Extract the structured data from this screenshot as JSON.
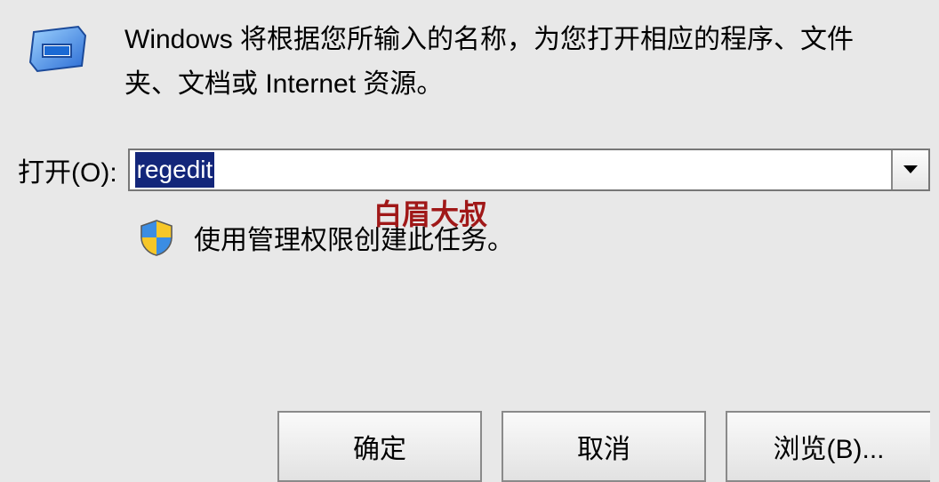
{
  "description": "Windows 将根据您所输入的名称，为您打开相应的程序、文件夹、文档或 Internet 资源。",
  "open_label": "打开(O):",
  "open_value": "regedit",
  "admin_note": "使用管理权限创建此任务。",
  "watermark": "白眉大叔",
  "buttons": {
    "ok": "确定",
    "cancel": "取消",
    "browse": "浏览(B)..."
  }
}
